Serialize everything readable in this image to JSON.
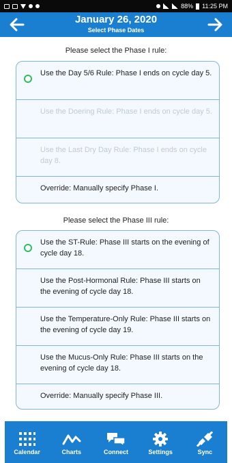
{
  "status_bar": {
    "time": "11:25 PM",
    "battery": "88%"
  },
  "header": {
    "title": "January 26, 2020",
    "subtitle": "Select Phase Dates"
  },
  "phase1": {
    "label": "Please select the Phase I rule:",
    "options": [
      {
        "text": "Use the Day 5/6 Rule: Phase I ends on cycle day 5."
      },
      {
        "text": "Use the Doering Rule: Phase I ends on cycle day 5."
      },
      {
        "text": "Use the Last Dry Day Rule: Phase I ends on cycle day 8."
      },
      {
        "text": "Override: Manually specify Phase I."
      }
    ]
  },
  "phase3": {
    "label": "Please select the Phase III rule:",
    "options": [
      {
        "text": "Use the ST-Rule: Phase III starts on the evening of cycle day 18."
      },
      {
        "text": "Use the Post-Hormonal Rule: Phase III starts on the evening of cycle day 18."
      },
      {
        "text": "Use the Temperature-Only Rule: Phase III starts on the evening of cycle day 19."
      },
      {
        "text": "Use the Mucus-Only Rule: Phase III starts on the evening of cycle day 18."
      },
      {
        "text": "Override: Manually specify Phase III."
      }
    ]
  },
  "tabs": [
    {
      "label": "Calendar"
    },
    {
      "label": "Charts"
    },
    {
      "label": "Connect"
    },
    {
      "label": "Settings"
    },
    {
      "label": "Sync"
    }
  ],
  "colors": {
    "header_bg": "#1a7fd1",
    "selected_radio": "#2dbf5b",
    "border": "#7fb5e3",
    "disabled_text": "#c2cbd3"
  }
}
